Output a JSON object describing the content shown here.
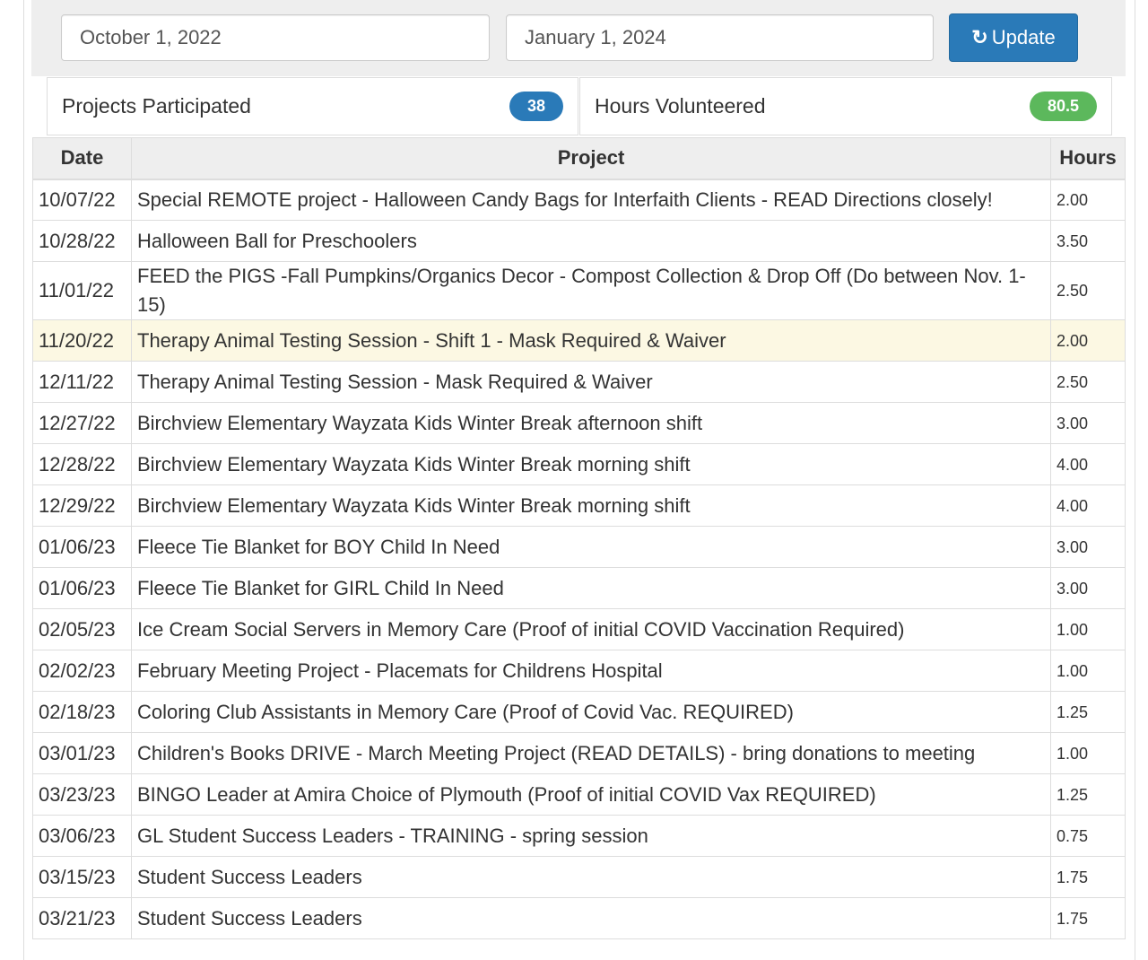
{
  "filters": {
    "start_date": "October 1, 2022",
    "end_date": "January 1, 2024",
    "update_label": "Update"
  },
  "summary": {
    "projects_label": "Projects Participated",
    "projects_count": "38",
    "hours_label": "Hours Volunteered",
    "hours_total": "80.5"
  },
  "colors": {
    "primary": "#2a7ab8",
    "success": "#5cb85c",
    "highlight": "#fcf8e3"
  },
  "table": {
    "headers": [
      "Date",
      "Project",
      "Hours"
    ],
    "rows": [
      [
        "10/07/22",
        "Special REMOTE project - Halloween Candy Bags for Interfaith Clients - READ Directions closely!",
        "2.00"
      ],
      [
        "10/28/22",
        "Halloween Ball for Preschoolers",
        "3.50"
      ],
      [
        "11/01/22",
        "FEED the PIGS -Fall Pumpkins/Organics Decor - Compost Collection & Drop Off (Do between Nov. 1-15)",
        "2.50"
      ],
      [
        "11/20/22",
        "Therapy Animal Testing Session - Shift 1 - Mask Required & Waiver",
        "2.00"
      ],
      [
        "12/11/22",
        "Therapy Animal Testing Session - Mask Required & Waiver",
        "2.50"
      ],
      [
        "12/27/22",
        "Birchview Elementary Wayzata Kids Winter Break afternoon shift",
        "3.00"
      ],
      [
        "12/28/22",
        "Birchview Elementary Wayzata Kids Winter Break morning shift",
        "4.00"
      ],
      [
        "12/29/22",
        "Birchview Elementary Wayzata Kids Winter Break morning shift",
        "4.00"
      ],
      [
        "01/06/23",
        "Fleece Tie Blanket for BOY Child In Need",
        "3.00"
      ],
      [
        "01/06/23",
        "Fleece Tie Blanket for GIRL Child In Need",
        "3.00"
      ],
      [
        "02/05/23",
        "Ice Cream Social Servers in Memory Care (Proof of initial COVID Vaccination Required)",
        "1.00"
      ],
      [
        "02/02/23",
        "February Meeting Project - Placemats for Childrens Hospital",
        "1.00"
      ],
      [
        "02/18/23",
        "Coloring Club Assistants in Memory Care (Proof of Covid Vac. REQUIRED)",
        "1.25"
      ],
      [
        "03/01/23",
        "Children's Books DRIVE - March Meeting Project (READ DETAILS) - bring donations to meeting",
        "1.00"
      ],
      [
        "03/23/23",
        "BINGO Leader at Amira Choice of Plymouth (Proof of initial COVID Vax REQUIRED)",
        "1.25"
      ],
      [
        "03/06/23",
        "GL Student Success Leaders - TRAINING - spring session",
        "0.75"
      ],
      [
        "03/15/23",
        "Student Success Leaders",
        "1.75"
      ],
      [
        "03/21/23",
        "Student Success Leaders",
        "1.75"
      ]
    ],
    "highlighted_row": 3
  }
}
